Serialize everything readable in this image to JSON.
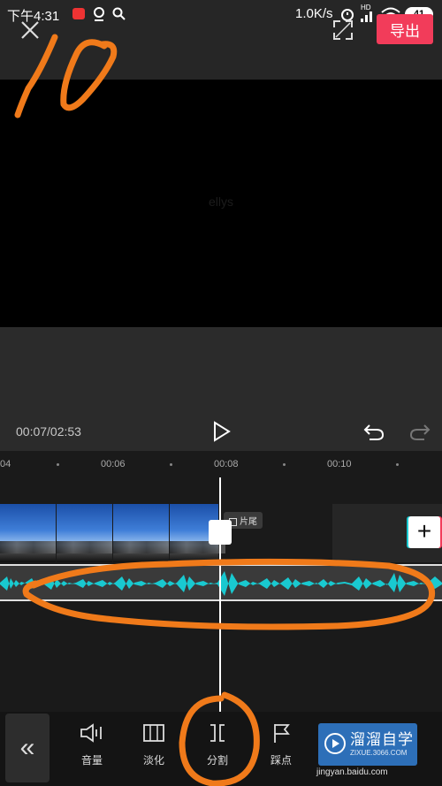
{
  "status_bar": {
    "time": "下午4:31",
    "speed": "1.0K/s",
    "network": "HD",
    "battery": "41"
  },
  "top_bar": {
    "export_label": "导出"
  },
  "preview": {
    "watermark_text": "ellys"
  },
  "controls": {
    "time_display": "00:07/02:53"
  },
  "ruler": {
    "ticks": [
      "04",
      "00:06",
      "00:08",
      "00:10"
    ]
  },
  "timeline": {
    "ending_label": "片尾",
    "add_label": "+"
  },
  "toolbar": {
    "back_label": "«",
    "tools": [
      {
        "label": "音量",
        "icon": "volume-icon"
      },
      {
        "label": "淡化",
        "icon": "fade-icon"
      },
      {
        "label": "分割",
        "icon": "split-icon"
      },
      {
        "label": "踩点",
        "icon": "flag-icon"
      }
    ]
  },
  "watermark": {
    "title": "溜溜自学",
    "subtitle": "ZIXUE.3066.COM",
    "jingyan": "jingyan.baidu.com"
  },
  "annotation": {
    "handwritten_text": "10",
    "color": "#f07a1a"
  },
  "colors": {
    "accent": "#f23c5a",
    "waveform": "#19c9d0",
    "annotation": "#f07a1a"
  }
}
